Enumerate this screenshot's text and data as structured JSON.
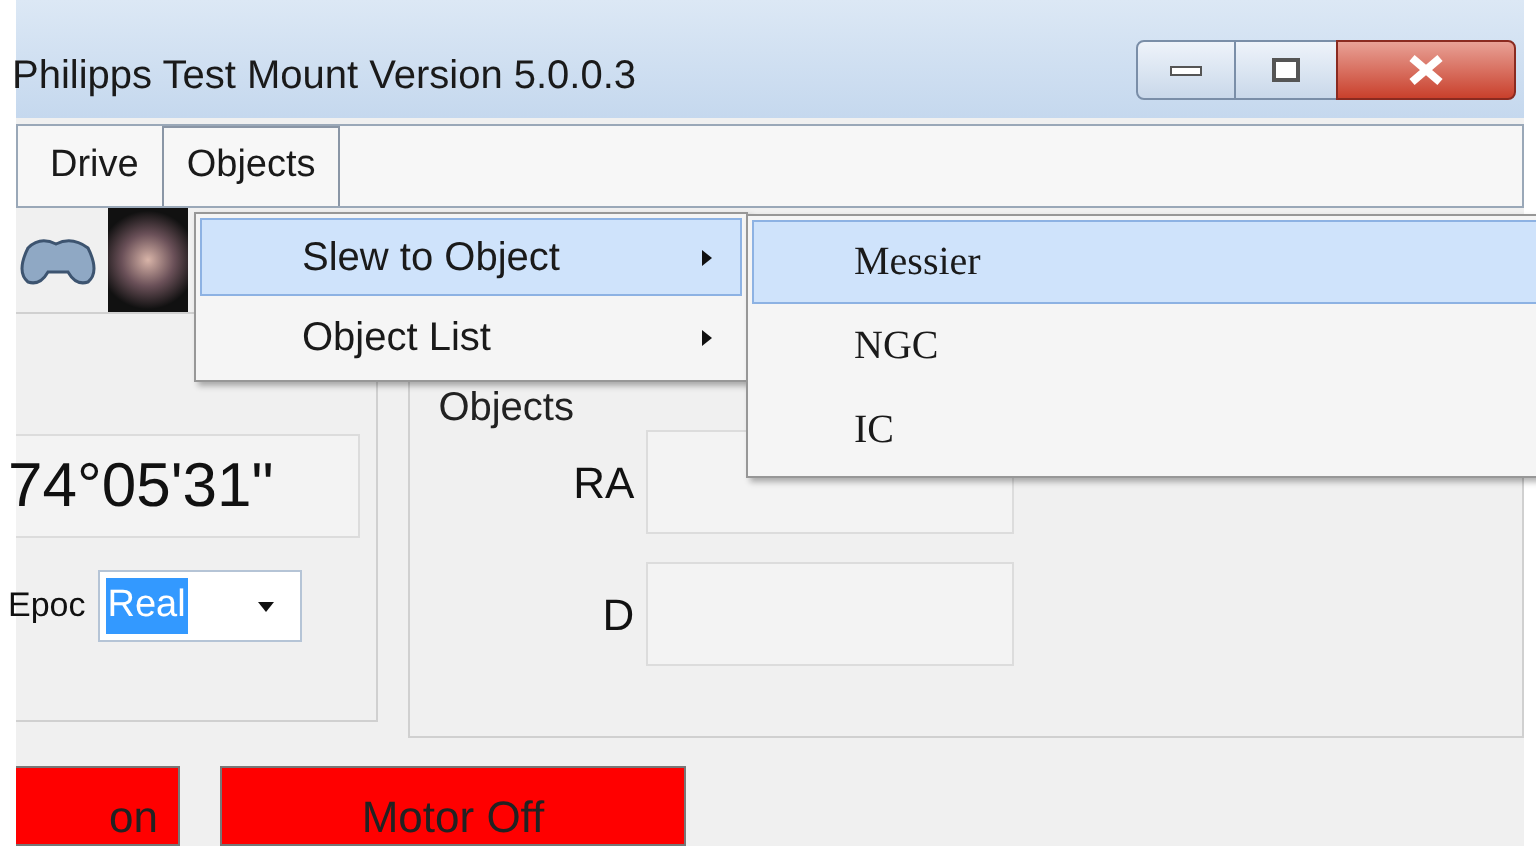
{
  "window": {
    "title": "Philipps Test Mount Version 5.0.0.3"
  },
  "menu_bar": [
    {
      "label": "Drive",
      "selected": false
    },
    {
      "label": "Objects",
      "selected": true
    }
  ],
  "dropdown": [
    {
      "label": "Slew to Object",
      "selected": true
    },
    {
      "label": "Object List",
      "selected": false
    }
  ],
  "submenu": [
    {
      "label": "Messier",
      "selected": true
    },
    {
      "label": "NGC",
      "selected": false
    },
    {
      "label": "IC",
      "selected": false
    }
  ],
  "position_panel": {
    "value": "74°05'31\"",
    "epoch_label": "Epoc",
    "epoch_value": "Real"
  },
  "objects_panel": {
    "title": "Objects",
    "fields": [
      {
        "label": "RA"
      },
      {
        "label": "D"
      }
    ]
  },
  "buttons": [
    {
      "label": "on"
    },
    {
      "label": "Motor Off"
    }
  ]
}
